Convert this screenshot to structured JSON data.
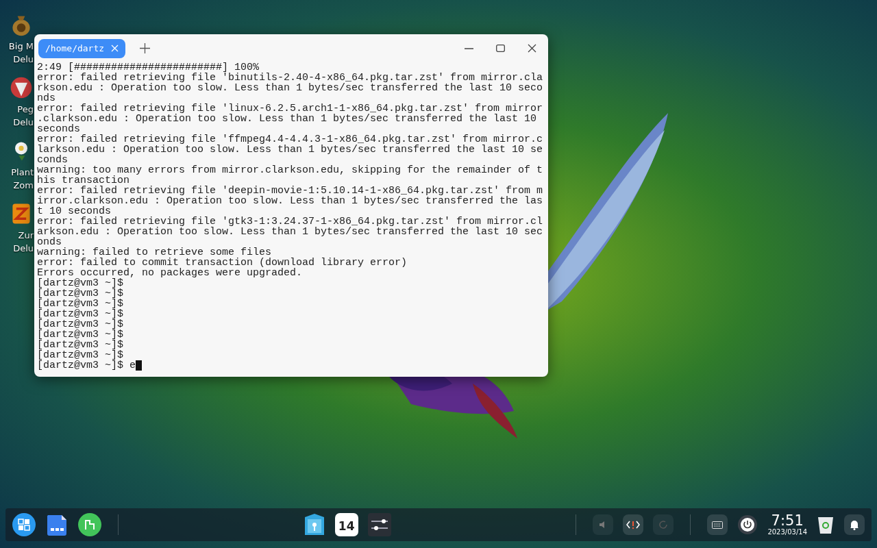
{
  "desktop_icons": [
    {
      "label_lines": [
        "Big M",
        "Delu"
      ]
    },
    {
      "label_lines": [
        "Peg",
        "Delu"
      ]
    },
    {
      "label_lines": [
        "Plant",
        "Zom"
      ]
    },
    {
      "label_lines": [
        "Zur",
        "Delu"
      ]
    }
  ],
  "window": {
    "tabs": [
      {
        "label": "/home/dartz",
        "selected": true
      }
    ],
    "terminal": {
      "lines": [
        "2:49 [########################] 100%",
        "error: failed retrieving file 'binutils-2.40-4-x86_64.pkg.tar.zst' from mirror.cla",
        "rkson.edu : Operation too slow. Less than 1 bytes/sec transferred the last 10 seco",
        "nds",
        "error: failed retrieving file 'linux-6.2.5.arch1-1-x86_64.pkg.tar.zst' from mirror",
        ".clarkson.edu : Operation too slow. Less than 1 bytes/sec transferred the last 10",
        "seconds",
        "error: failed retrieving file 'ffmpeg4.4-4.4.3-1-x86_64.pkg.tar.zst' from mirror.c",
        "larkson.edu : Operation too slow. Less than 1 bytes/sec transferred the last 10 se",
        "conds",
        "warning: too many errors from mirror.clarkson.edu, skipping for the remainder of t",
        "his transaction",
        "error: failed retrieving file 'deepin-movie-1:5.10.14-1-x86_64.pkg.tar.zst' from m",
        "irror.clarkson.edu : Operation too slow. Less than 1 bytes/sec transferred the las",
        "t 10 seconds",
        "error: failed retrieving file 'gtk3-1:3.24.37-1-x86_64.pkg.tar.zst' from mirror.cl",
        "arkson.edu : Operation too slow. Less than 1 bytes/sec transferred the last 10 sec",
        "onds",
        "warning: failed to retrieve some files",
        "error: failed to commit transaction (download library error)",
        "Errors occurred, no packages were upgraded.",
        "[dartz@vm3 ~]$",
        "[dartz@vm3 ~]$",
        "[dartz@vm3 ~]$",
        "[dartz@vm3 ~]$",
        "[dartz@vm3 ~]$",
        "[dartz@vm3 ~]$",
        "[dartz@vm3 ~]$",
        "[dartz@vm3 ~]$"
      ],
      "prompt": "[dartz@vm3 ~]$",
      "input": "e"
    }
  },
  "taskbar": {
    "calendar_day": "14",
    "clock": {
      "time": "7:51",
      "date": "2023/03/14"
    }
  }
}
